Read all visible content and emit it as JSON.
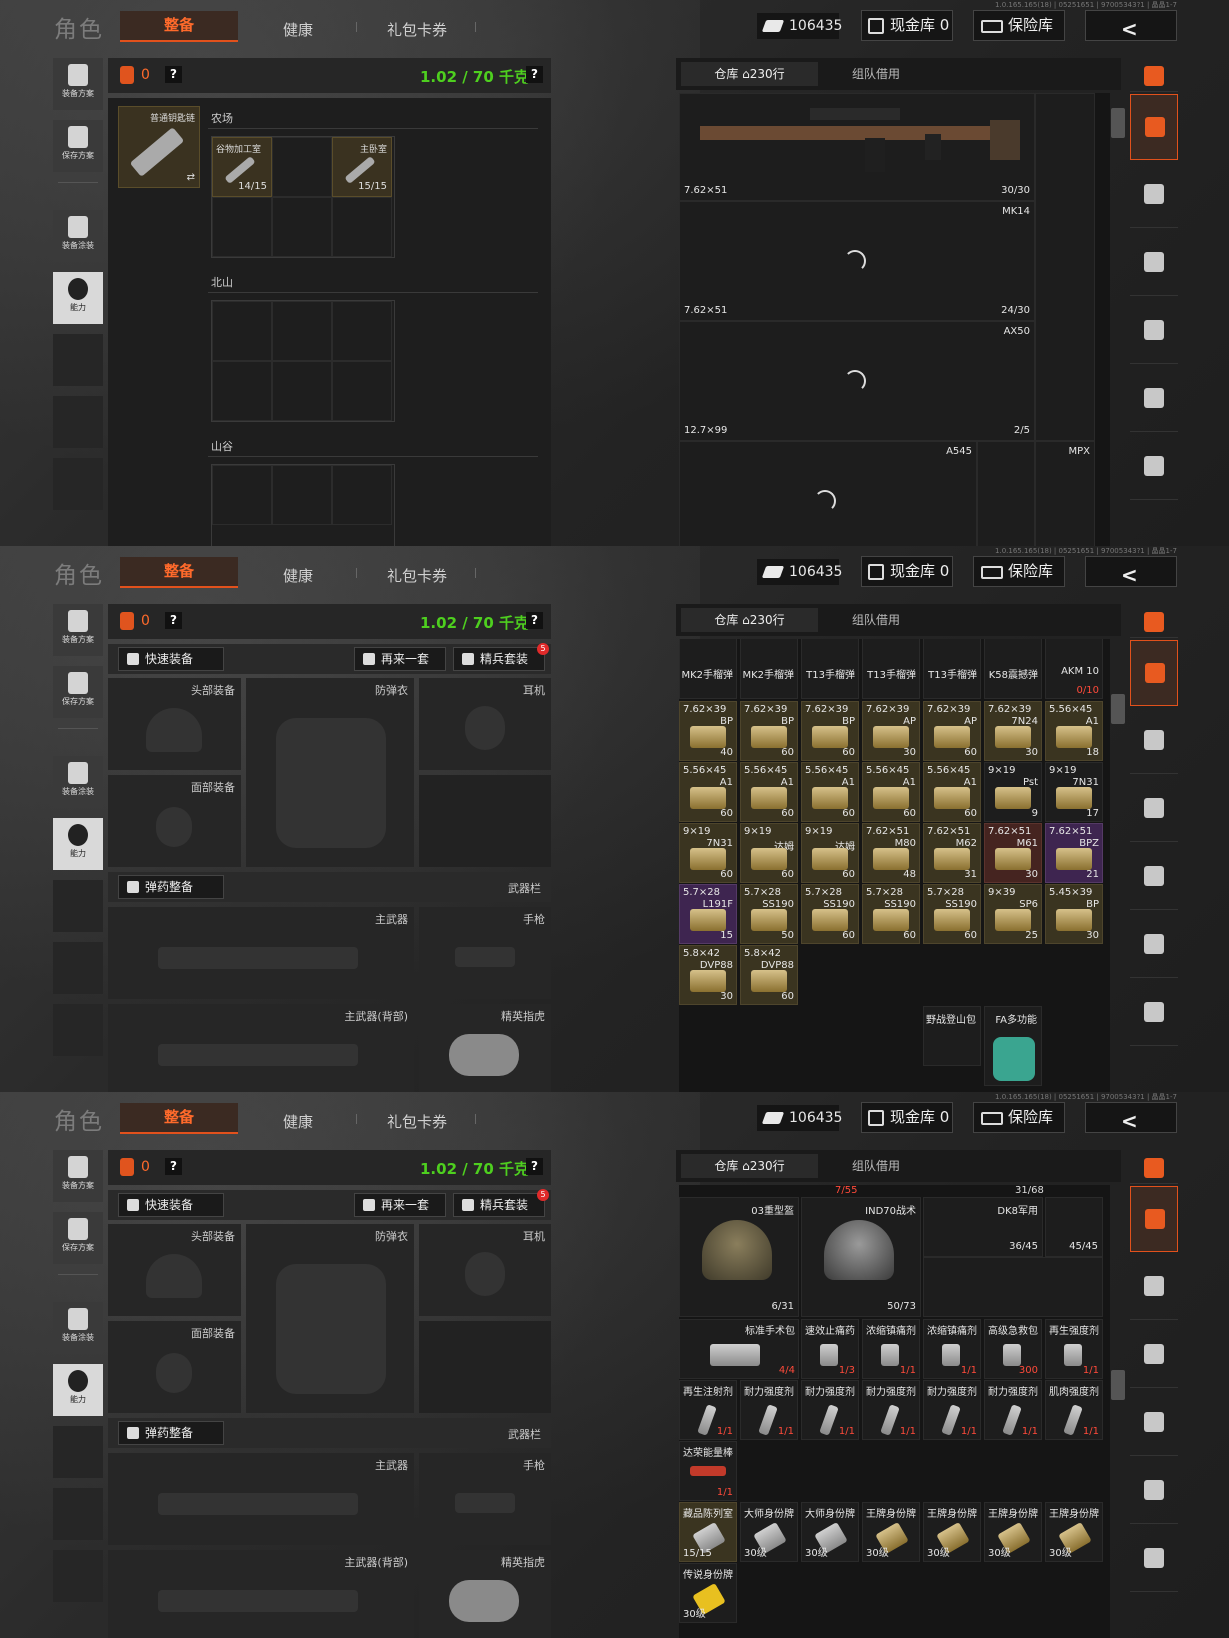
{
  "header": {
    "role": "角色",
    "tabs": [
      "整备",
      "健康",
      "礼包卡券"
    ],
    "money": "106435",
    "cash_store": "现金库 0",
    "safe": "保险库",
    "version": "1.0.165.165(18) | 05251651 | 97005343?1 | 晶晶1-7"
  },
  "leftnav": {
    "plan": "装备方案",
    "save": "保存方案",
    "paint": "装备涂装",
    "ability": "能力"
  },
  "loadout": {
    "bag_count": "0",
    "weight": "1.02 / 70 千克",
    "help": "?"
  },
  "panel1": {
    "keychain": "普通钥匙链",
    "sections": [
      "农场",
      "北山",
      "山谷"
    ],
    "keys": [
      {
        "name": "谷物加工室",
        "count": "14/15"
      },
      {
        "name": "主卧室",
        "count": "15/15"
      }
    ]
  },
  "equip": {
    "quick": "快速装备",
    "again": "再来一套",
    "elite": "精兵套装",
    "elite_badge": "5",
    "slots": [
      "头部装备",
      "防弹衣",
      "耳机",
      "面部装备"
    ],
    "ammo_btn": "弹药整备",
    "weapon_bar": "武器栏",
    "weapons": [
      "主武器",
      "手枪",
      "主武器(背部)",
      "精英指虎"
    ]
  },
  "stash": {
    "tab_warehouse": "仓库",
    "warehouse_rows": "230行",
    "tab_team": "组队借用",
    "panel1_items": [
      {
        "cal": "7.62×51",
        "count": "30/30",
        "name": ""
      },
      {
        "cal": "7.62×51",
        "count": "24/30",
        "name": "MK14"
      },
      {
        "cal": "12.7×99",
        "count": "2/5",
        "name": "AX50"
      },
      {
        "cal": "",
        "count": "",
        "name": "A545"
      },
      {
        "cal": "",
        "count": "",
        "name": "MPX"
      }
    ],
    "panel2_row0": [
      "MK2手榴弹",
      "MK2手榴弹",
      "T13手榴弹",
      "T13手榴弹",
      "T13手榴弹",
      "K58震撼弹",
      "AKM 10"
    ],
    "panel2_row0_count": [
      "",
      "",
      "",
      "",
      "",
      "",
      "0/10"
    ],
    "panel2_ammo": [
      [
        [
          "7.62×39",
          "BP",
          "40",
          "am"
        ],
        [
          "7.62×39",
          "BP",
          "60",
          "am"
        ],
        [
          "7.62×39",
          "BP",
          "60",
          "am"
        ],
        [
          "7.62×39",
          "AP",
          "30",
          "am"
        ],
        [
          "7.62×39",
          "AP",
          "60",
          "am"
        ],
        [
          "7.62×39",
          "7N24",
          "30",
          "am"
        ],
        [
          "5.56×45",
          "A1",
          "18",
          "am"
        ]
      ],
      [
        [
          "5.56×45",
          "A1",
          "60",
          "am"
        ],
        [
          "5.56×45",
          "A1",
          "60",
          "am"
        ],
        [
          "5.56×45",
          "A1",
          "60",
          "am"
        ],
        [
          "5.56×45",
          "A1",
          "60",
          "am"
        ],
        [
          "5.56×45",
          "A1",
          "60",
          "am"
        ],
        [
          "9×19",
          "Pst",
          "9",
          ""
        ],
        [
          "9×19",
          "7N31",
          "17",
          ""
        ]
      ],
      [
        [
          "9×19",
          "7N31",
          "60",
          "am"
        ],
        [
          "9×19",
          "达姆",
          "60",
          "am"
        ],
        [
          "9×19",
          "达姆",
          "60",
          "am"
        ],
        [
          "7.62×51",
          "M80",
          "48",
          "am"
        ],
        [
          "7.62×51",
          "M62",
          "31",
          "am"
        ],
        [
          "7.62×51",
          "M61",
          "30",
          "rd"
        ],
        [
          "7.62×51",
          "BPZ",
          "21",
          "pu"
        ]
      ],
      [
        [
          "5.7×28",
          "L191F",
          "15",
          "pu"
        ],
        [
          "5.7×28",
          "SS190",
          "50",
          "am"
        ],
        [
          "5.7×28",
          "SS190",
          "60",
          "am"
        ],
        [
          "5.7×28",
          "SS190",
          "60",
          "am"
        ],
        [
          "5.7×28",
          "SS190",
          "60",
          "am"
        ],
        [
          "9×39",
          "SP6",
          "25",
          "am"
        ],
        [
          "5.45×39",
          "BP",
          "30",
          "am"
        ]
      ],
      [
        [
          "5.8×42",
          "DVP88",
          "30",
          "am"
        ],
        [
          "5.8×42",
          "DVP88",
          "60",
          "am"
        ]
      ]
    ],
    "panel2_bottom": [
      "野战登山包",
      "FA多功能"
    ],
    "panel3_top": [
      "7/55",
      "31/68"
    ],
    "panel3_helmets": [
      {
        "name": "03重型盔",
        "count": "6/31"
      },
      {
        "name": "IND70战术",
        "count": "50/73"
      },
      {
        "name": "DK8军用",
        "count": "36/45"
      },
      {
        "name": "",
        "count": "45/45"
      }
    ],
    "panel3_med": [
      {
        "name": "标准手术包",
        "count": "4/4"
      },
      {
        "name": "速效止痛药",
        "count": "1/3"
      },
      {
        "name": "浓缩镇痛剂",
        "count": "1/1"
      },
      {
        "name": "浓缩镇痛剂",
        "count": "1/1"
      },
      {
        "name": "高级急救包",
        "count": "300"
      },
      {
        "name": "再生强度剂",
        "count": "1/1"
      }
    ],
    "panel3_inj": [
      {
        "name": "再生注射剂",
        "count": "1/1"
      },
      {
        "name": "耐力强度剂",
        "count": "1/1"
      },
      {
        "name": "耐力强度剂",
        "count": "1/1"
      },
      {
        "name": "耐力强度剂",
        "count": "1/1"
      },
      {
        "name": "耐力强度剂",
        "count": "1/1"
      },
      {
        "name": "耐力强度剂",
        "count": "1/1"
      },
      {
        "name": "肌肉强度剂",
        "count": "1/1"
      }
    ],
    "panel3_bar": {
      "name": "达荣能量棒",
      "count": "1/1"
    },
    "panel3_tags": [
      {
        "name": "藏品陈列室",
        "count": "15/15"
      },
      {
        "name": "大师身份牌",
        "count": "30级"
      },
      {
        "name": "大师身份牌",
        "count": "30级"
      },
      {
        "name": "王牌身份牌",
        "count": "30级"
      },
      {
        "name": "王牌身份牌",
        "count": "30级"
      },
      {
        "name": "王牌身份牌",
        "count": "30级"
      },
      {
        "name": "王牌身份牌",
        "count": "30级"
      }
    ],
    "panel3_legend": {
      "name": "传说身份牌",
      "count": "30级"
    }
  }
}
